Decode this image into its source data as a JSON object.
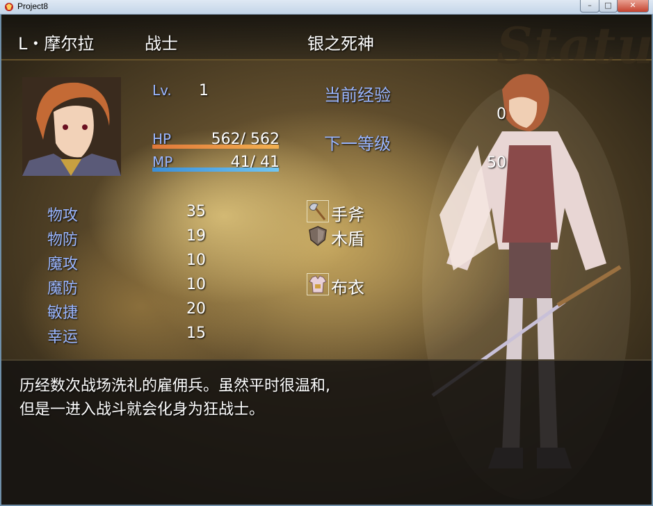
{
  "window": {
    "title": "Project8",
    "min_glyph": "–",
    "max_glyph": "□",
    "close_glyph": "✕"
  },
  "header": {
    "name": "L・摩尔拉",
    "class": "战士",
    "nickname": "银之死神",
    "watermark": "Status"
  },
  "vitals": {
    "lv_label": "Lv.",
    "lv_value": "1",
    "hp_label": "HP",
    "hp_value": "562/  562",
    "hp_fraction": 1.0,
    "mp_label": "MP",
    "mp_value": "41/   41",
    "mp_fraction": 1.0
  },
  "experience": {
    "current_label": "当前经验",
    "current_value": "0",
    "next_label": "下一等级",
    "next_value": "50"
  },
  "params": [
    {
      "label": "物攻",
      "value": "35"
    },
    {
      "label": "物防",
      "value": "19"
    },
    {
      "label": "魔攻",
      "value": "10"
    },
    {
      "label": "魔防",
      "value": "10"
    },
    {
      "label": "敏捷",
      "value": "20"
    },
    {
      "label": "幸运",
      "value": "15"
    }
  ],
  "equipment": [
    {
      "icon": "axe-icon",
      "name": "手斧"
    },
    {
      "icon": "shield-icon",
      "name": "木盾"
    },
    {
      "icon": "armor-icon",
      "name": "布衣"
    }
  ],
  "description": {
    "line1": "历经数次战场洗礼的雇佣兵。虽然平时很温和,",
    "line2": "但是一进入战斗就会化身为狂战士。"
  },
  "colors": {
    "system_blue": "#9ab6ff",
    "hp_gauge": "#f0a048",
    "mp_gauge": "#4aa8e8"
  }
}
